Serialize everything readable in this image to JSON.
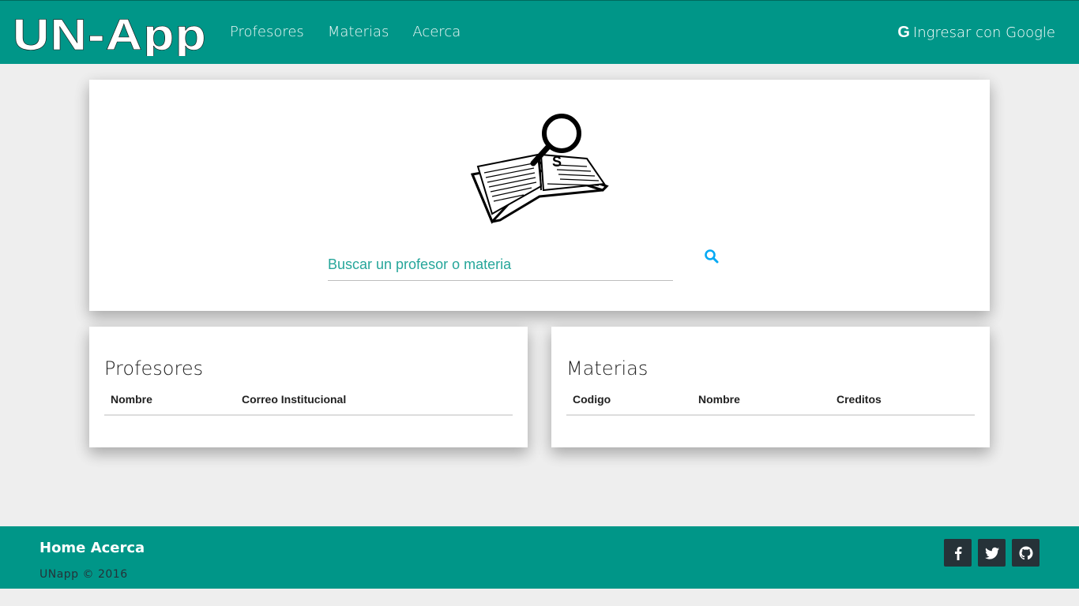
{
  "navbar": {
    "logo_text": "UN-App",
    "links": [
      "Profesores",
      "Materias",
      "Acerca"
    ],
    "login_icon": "G",
    "login_label": "Ingresar con Google"
  },
  "search": {
    "placeholder": "Buscar un profesor o materia",
    "icon": "search-icon"
  },
  "profesores": {
    "title": "Profesores",
    "columns": [
      "Nombre",
      "Correo Institucional"
    ]
  },
  "materias": {
    "title": "Materias",
    "columns": [
      "Codigo",
      "Nombre",
      "Creditos"
    ]
  },
  "footer": {
    "link_home": "Home",
    "link_acerca": "Acerca",
    "copyright": "UNapp © 2016",
    "social": [
      "facebook-icon",
      "twitter-icon",
      "github-icon"
    ]
  },
  "colors": {
    "primary": "#009688",
    "accent": "#26a69a",
    "search_icon": "#03a9f4",
    "social_bg": "#263238"
  }
}
